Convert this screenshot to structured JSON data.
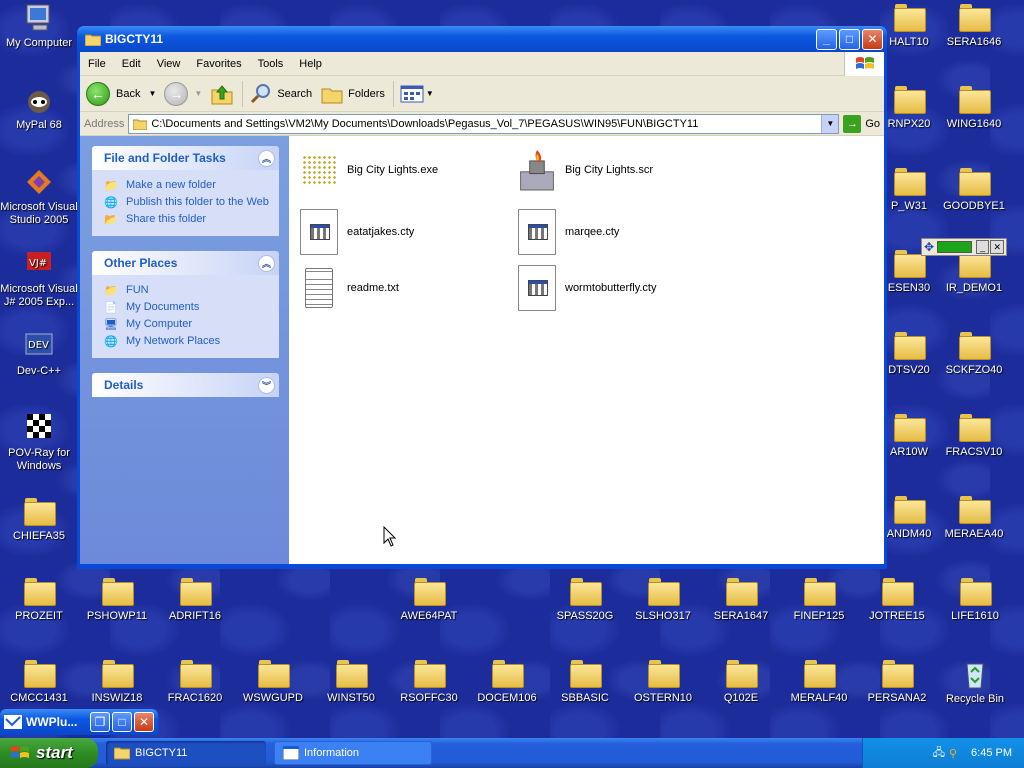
{
  "desktop": {
    "left_icons": [
      {
        "label": "My Computer",
        "icon": "my-computer-icon"
      },
      {
        "label": "MyPal 68",
        "icon": "mypal-icon"
      },
      {
        "label": "Microsoft Visual Studio 2005",
        "icon": "visual-studio-icon"
      },
      {
        "label": "Microsoft Visual J# 2005 Exp...",
        "icon": "vjsharp-icon"
      },
      {
        "label": "Dev-C++",
        "icon": "dev-cpp-icon"
      },
      {
        "label": "POV-Ray for Windows",
        "icon": "povray-icon"
      },
      {
        "label": "CHIEFA35",
        "icon": "folder-icon"
      }
    ],
    "right_col1": [
      "HALT10",
      "RNPX20",
      "P_W31",
      "ESEN30",
      "DTSV20",
      "AR10W",
      "ANDM40"
    ],
    "right_col2": [
      "SERA1646",
      "WING1640",
      "GOODBYE1",
      "IR_DEMO1",
      "SCKFZO40",
      "FRACSV10",
      "MERAEA40"
    ],
    "bottom_row1": [
      "PROZEIT",
      "PSHOWP11",
      "ADRIFT16",
      "AWE64PAT",
      "SPASS20G",
      "SLSHO317",
      "SERA1647",
      "FINEP125",
      "JOTREE15",
      "LIFE1610"
    ],
    "bottom_row2": [
      "CMCC1431",
      "INSWIZ18",
      "FRAC1620",
      "WSWGUPD",
      "WINST50",
      "RSOFFC30",
      "DOCEM106",
      "SBBASIC",
      "OSTERN10",
      "Q102E",
      "MERALF40",
      "PERSANA2",
      "Recycle Bin"
    ]
  },
  "window": {
    "title": "BIGCTY11",
    "menu": [
      "File",
      "Edit",
      "View",
      "Favorites",
      "Tools",
      "Help"
    ],
    "toolbar": {
      "back": "Back",
      "search": "Search",
      "folders": "Folders"
    },
    "address": {
      "label": "Address",
      "value": "C:\\Documents and Settings\\VM2\\My Documents\\Downloads\\Pegasus_Vol_7\\PEGASUS\\WIN95\\FUN\\BIGCTY11",
      "go": "Go"
    },
    "tasks_panel": {
      "title": "File and Folder Tasks",
      "items": [
        "Make a new folder",
        "Publish this folder to the Web",
        "Share this folder"
      ]
    },
    "places_panel": {
      "title": "Other Places",
      "items": [
        "FUN",
        "My Documents",
        "My Computer",
        "My Network Places"
      ]
    },
    "details_panel": {
      "title": "Details"
    },
    "files": [
      {
        "name": "Big City Lights.exe",
        "icon": "exe-icon"
      },
      {
        "name": "Big City Lights.scr",
        "icon": "screensaver-icon"
      },
      {
        "name": "eatatjakes.cty",
        "icon": "cty-file-icon"
      },
      {
        "name": "marqee.cty",
        "icon": "cty-file-icon"
      },
      {
        "name": "readme.txt",
        "icon": "text-file-icon"
      },
      {
        "name": "wormtobutterfly.cty",
        "icon": "cty-file-icon"
      }
    ]
  },
  "mini_window": {
    "title": "WWPlu..."
  },
  "taskbar": {
    "start": "start",
    "tasks": [
      "BIGCTY11",
      "Information"
    ],
    "clock": "6:45 PM"
  },
  "colors": {
    "desktop": "#1c2c9a",
    "titlebar": "#0a49d8",
    "start": "#2f8c25"
  }
}
